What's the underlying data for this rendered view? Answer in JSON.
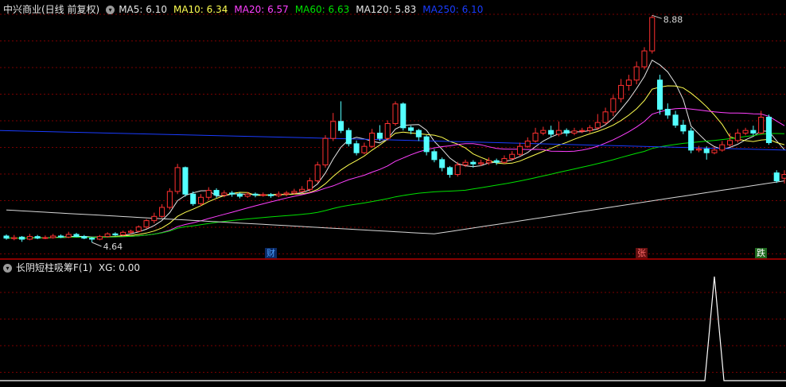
{
  "main_header": {
    "title": "中兴商业(日线 前复权)",
    "ma": [
      {
        "label": "MA5: 6.10",
        "color": "#e6e6e6"
      },
      {
        "label": "MA10: 6.34",
        "color": "#ffff50"
      },
      {
        "label": "MA20: 6.57",
        "color": "#ff40ff"
      },
      {
        "label": "MA60: 6.63",
        "color": "#00e000"
      },
      {
        "label": "MA120: 5.83",
        "color": "#e6e6e6"
      },
      {
        "label": "MA250: 6.10",
        "color": "#1a3cff"
      }
    ]
  },
  "annotations": {
    "high": "8.88",
    "low": "4.64"
  },
  "markers": [
    {
      "label": "财",
      "color": "#4aa0ff",
      "bg": "#0b2a66"
    },
    {
      "label": "张",
      "color": "#ff6a6a",
      "bg": "#661010"
    },
    {
      "label": "跌",
      "color": "#ffffff",
      "bg": "#1f6a1f"
    }
  ],
  "sub_header": {
    "title": "长阴短柱吸筹F(1)",
    "value": "XG: 0.00"
  },
  "colors": {
    "up": "#ff3030",
    "down": "#54ffff",
    "grid": "#7a0000",
    "divider": "#8b0000"
  },
  "chart_data": {
    "type": "candlestick",
    "title": "中兴商业(日线 前复权)",
    "ylim": [
      4.5,
      9.0
    ],
    "candles": [
      [
        4.76,
        4.72,
        4.79,
        4.69
      ],
      [
        4.71,
        4.73,
        4.78,
        4.68
      ],
      [
        4.74,
        4.7,
        4.76,
        4.65
      ],
      [
        4.7,
        4.75,
        4.8,
        4.68
      ],
      [
        4.75,
        4.72,
        4.78,
        4.7
      ],
      [
        4.72,
        4.73,
        4.77,
        4.7
      ],
      [
        4.73,
        4.76,
        4.8,
        4.71
      ],
      [
        4.76,
        4.74,
        4.79,
        4.72
      ],
      [
        4.74,
        4.79,
        4.84,
        4.72
      ],
      [
        4.79,
        4.75,
        4.82,
        4.74
      ],
      [
        4.75,
        4.72,
        4.78,
        4.7
      ],
      [
        4.72,
        4.7,
        4.74,
        4.64
      ],
      [
        4.7,
        4.75,
        4.78,
        4.68
      ],
      [
        4.75,
        4.8,
        4.83,
        4.73
      ],
      [
        4.8,
        4.78,
        4.83,
        4.76
      ],
      [
        4.78,
        4.83,
        4.86,
        4.76
      ],
      [
        4.83,
        4.85,
        4.88,
        4.8
      ],
      [
        4.85,
        4.93,
        4.96,
        4.83
      ],
      [
        4.93,
        5.05,
        5.08,
        4.9
      ],
      [
        5.05,
        5.13,
        5.2,
        5.0
      ],
      [
        5.13,
        5.3,
        5.36,
        5.1
      ],
      [
        5.3,
        5.6,
        5.66,
        5.26
      ],
      [
        5.6,
        6.05,
        6.12,
        5.55
      ],
      [
        6.05,
        5.55,
        6.07,
        5.5
      ],
      [
        5.55,
        5.37,
        5.6,
        5.33
      ],
      [
        5.37,
        5.49,
        5.55,
        5.33
      ],
      [
        5.49,
        5.62,
        5.68,
        5.44
      ],
      [
        5.62,
        5.53,
        5.66,
        5.48
      ],
      [
        5.53,
        5.57,
        5.62,
        5.49
      ],
      [
        5.57,
        5.55,
        5.61,
        5.5
      ],
      [
        5.55,
        5.51,
        5.58,
        5.47
      ],
      [
        5.51,
        5.55,
        5.59,
        5.48
      ],
      [
        5.55,
        5.53,
        5.58,
        5.49
      ],
      [
        5.53,
        5.54,
        5.58,
        5.5
      ],
      [
        5.54,
        5.52,
        5.57,
        5.48
      ],
      [
        5.52,
        5.55,
        5.6,
        5.49
      ],
      [
        5.55,
        5.57,
        5.61,
        5.51
      ],
      [
        5.57,
        5.6,
        5.65,
        5.54
      ],
      [
        5.6,
        5.64,
        5.7,
        5.58
      ],
      [
        5.64,
        5.8,
        5.86,
        5.6
      ],
      [
        5.8,
        6.1,
        6.16,
        5.76
      ],
      [
        6.1,
        6.6,
        6.66,
        6.05
      ],
      [
        6.6,
        6.92,
        7.08,
        6.55
      ],
      [
        6.92,
        6.75,
        7.3,
        6.7
      ],
      [
        6.75,
        6.5,
        6.8,
        6.45
      ],
      [
        6.5,
        6.33,
        6.56,
        6.28
      ],
      [
        6.33,
        6.45,
        6.52,
        6.3
      ],
      [
        6.45,
        6.7,
        6.78,
        6.42
      ],
      [
        6.7,
        6.6,
        6.85,
        6.55
      ],
      [
        6.6,
        6.88,
        6.94,
        6.56
      ],
      [
        6.88,
        7.25,
        7.3,
        6.84
      ],
      [
        7.25,
        6.8,
        7.28,
        6.75
      ],
      [
        6.8,
        6.75,
        6.84,
        6.68
      ],
      [
        6.75,
        6.63,
        6.78,
        6.55
      ],
      [
        6.63,
        6.35,
        6.66,
        6.28
      ],
      [
        6.35,
        6.2,
        6.4,
        6.15
      ],
      [
        6.2,
        6.05,
        6.24,
        5.98
      ],
      [
        6.05,
        5.92,
        6.08,
        5.86
      ],
      [
        5.92,
        6.1,
        6.16,
        5.88
      ],
      [
        6.1,
        6.15,
        6.2,
        6.06
      ],
      [
        6.15,
        6.12,
        6.19,
        6.05
      ],
      [
        6.12,
        6.14,
        6.2,
        6.08
      ],
      [
        6.14,
        6.18,
        6.24,
        6.1
      ],
      [
        6.18,
        6.15,
        6.22,
        6.1
      ],
      [
        6.15,
        6.22,
        6.28,
        6.12
      ],
      [
        6.22,
        6.3,
        6.36,
        6.18
      ],
      [
        6.3,
        6.45,
        6.52,
        6.26
      ],
      [
        6.45,
        6.55,
        6.62,
        6.42
      ],
      [
        6.55,
        6.7,
        6.8,
        6.52
      ],
      [
        6.7,
        6.75,
        6.82,
        6.66
      ],
      [
        6.75,
        6.68,
        6.84,
        6.62
      ],
      [
        6.68,
        6.75,
        6.92,
        6.64
      ],
      [
        6.75,
        6.7,
        6.79,
        6.64
      ],
      [
        6.7,
        6.74,
        6.8,
        6.66
      ],
      [
        6.74,
        6.75,
        6.8,
        6.7
      ],
      [
        6.75,
        6.8,
        6.85,
        6.71
      ],
      [
        6.8,
        6.9,
        7.06,
        6.76
      ],
      [
        6.9,
        7.1,
        7.18,
        6.86
      ],
      [
        7.1,
        7.35,
        7.42,
        7.02
      ],
      [
        7.35,
        7.6,
        7.72,
        7.28
      ],
      [
        7.6,
        7.7,
        7.8,
        7.5
      ],
      [
        7.7,
        7.95,
        8.05,
        7.62
      ],
      [
        7.95,
        8.25,
        8.32,
        7.9
      ],
      [
        8.25,
        8.88,
        8.92,
        8.2
      ],
      [
        7.7,
        7.15,
        7.8,
        7.05
      ],
      [
        7.15,
        7.04,
        7.26,
        6.97
      ],
      [
        7.04,
        6.85,
        7.12,
        6.8
      ],
      [
        6.85,
        6.74,
        6.95,
        6.68
      ],
      [
        6.74,
        6.38,
        6.8,
        6.32
      ],
      [
        6.38,
        6.4,
        6.46,
        6.34
      ],
      [
        6.4,
        6.33,
        6.45,
        6.2
      ],
      [
        6.33,
        6.38,
        6.44,
        6.3
      ],
      [
        6.38,
        6.48,
        6.55,
        6.35
      ],
      [
        6.48,
        6.56,
        6.7,
        6.44
      ],
      [
        6.56,
        6.7,
        6.78,
        6.52
      ],
      [
        6.7,
        6.75,
        6.8,
        6.66
      ],
      [
        6.75,
        6.7,
        6.84,
        6.66
      ],
      [
        6.7,
        7.0,
        7.12,
        6.68
      ],
      [
        7.0,
        6.52,
        7.05,
        6.48
      ],
      [
        5.95,
        5.8,
        6.0,
        5.76
      ],
      [
        5.85,
        5.92,
        6.0,
        5.75
      ]
    ],
    "xg_signal_index": 91,
    "xg_value": 0.0
  }
}
